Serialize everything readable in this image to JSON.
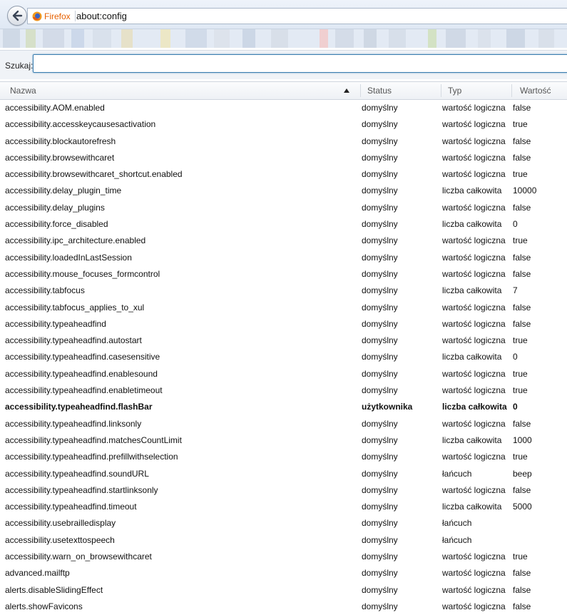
{
  "browser": {
    "identity_label": "Firefox",
    "url": "about:config",
    "accent": "#e66000"
  },
  "search": {
    "label": "Szukaj:",
    "value": ""
  },
  "columns": {
    "name": "Nazwa",
    "status": "Status",
    "type": "Typ",
    "value": "Wartość",
    "sorted_by": "name",
    "sort_icon": "triangle-up-icon"
  },
  "rows": [
    {
      "name": "accessibility.AOM.enabled",
      "status": "domyślny",
      "type": "wartość logiczna",
      "value": "false",
      "modified": false
    },
    {
      "name": "accessibility.accesskeycausesactivation",
      "status": "domyślny",
      "type": "wartość logiczna",
      "value": "true",
      "modified": false
    },
    {
      "name": "accessibility.blockautorefresh",
      "status": "domyślny",
      "type": "wartość logiczna",
      "value": "false",
      "modified": false
    },
    {
      "name": "accessibility.browsewithcaret",
      "status": "domyślny",
      "type": "wartość logiczna",
      "value": "false",
      "modified": false
    },
    {
      "name": "accessibility.browsewithcaret_shortcut.enabled",
      "status": "domyślny",
      "type": "wartość logiczna",
      "value": "true",
      "modified": false
    },
    {
      "name": "accessibility.delay_plugin_time",
      "status": "domyślny",
      "type": "liczba całkowita",
      "value": "10000",
      "modified": false
    },
    {
      "name": "accessibility.delay_plugins",
      "status": "domyślny",
      "type": "wartość logiczna",
      "value": "false",
      "modified": false
    },
    {
      "name": "accessibility.force_disabled",
      "status": "domyślny",
      "type": "liczba całkowita",
      "value": "0",
      "modified": false
    },
    {
      "name": "accessibility.ipc_architecture.enabled",
      "status": "domyślny",
      "type": "wartość logiczna",
      "value": "true",
      "modified": false
    },
    {
      "name": "accessibility.loadedInLastSession",
      "status": "domyślny",
      "type": "wartość logiczna",
      "value": "false",
      "modified": false
    },
    {
      "name": "accessibility.mouse_focuses_formcontrol",
      "status": "domyślny",
      "type": "wartość logiczna",
      "value": "false",
      "modified": false
    },
    {
      "name": "accessibility.tabfocus",
      "status": "domyślny",
      "type": "liczba całkowita",
      "value": "7",
      "modified": false
    },
    {
      "name": "accessibility.tabfocus_applies_to_xul",
      "status": "domyślny",
      "type": "wartość logiczna",
      "value": "false",
      "modified": false
    },
    {
      "name": "accessibility.typeaheadfind",
      "status": "domyślny",
      "type": "wartość logiczna",
      "value": "false",
      "modified": false
    },
    {
      "name": "accessibility.typeaheadfind.autostart",
      "status": "domyślny",
      "type": "wartość logiczna",
      "value": "true",
      "modified": false
    },
    {
      "name": "accessibility.typeaheadfind.casesensitive",
      "status": "domyślny",
      "type": "liczba całkowita",
      "value": "0",
      "modified": false
    },
    {
      "name": "accessibility.typeaheadfind.enablesound",
      "status": "domyślny",
      "type": "wartość logiczna",
      "value": "true",
      "modified": false
    },
    {
      "name": "accessibility.typeaheadfind.enabletimeout",
      "status": "domyślny",
      "type": "wartość logiczna",
      "value": "true",
      "modified": false
    },
    {
      "name": "accessibility.typeaheadfind.flashBar",
      "status": "użytkownika",
      "type": "liczba całkowita",
      "value": "0",
      "modified": true
    },
    {
      "name": "accessibility.typeaheadfind.linksonly",
      "status": "domyślny",
      "type": "wartość logiczna",
      "value": "false",
      "modified": false
    },
    {
      "name": "accessibility.typeaheadfind.matchesCountLimit",
      "status": "domyślny",
      "type": "liczba całkowita",
      "value": "1000",
      "modified": false
    },
    {
      "name": "accessibility.typeaheadfind.prefillwithselection",
      "status": "domyślny",
      "type": "wartość logiczna",
      "value": "true",
      "modified": false
    },
    {
      "name": "accessibility.typeaheadfind.soundURL",
      "status": "domyślny",
      "type": "łańcuch",
      "value": "beep",
      "modified": false
    },
    {
      "name": "accessibility.typeaheadfind.startlinksonly",
      "status": "domyślny",
      "type": "wartość logiczna",
      "value": "false",
      "modified": false
    },
    {
      "name": "accessibility.typeaheadfind.timeout",
      "status": "domyślny",
      "type": "liczba całkowita",
      "value": "5000",
      "modified": false
    },
    {
      "name": "accessibility.usebrailledisplay",
      "status": "domyślny",
      "type": "łańcuch",
      "value": "",
      "modified": false
    },
    {
      "name": "accessibility.usetexttospeech",
      "status": "domyślny",
      "type": "łańcuch",
      "value": "",
      "modified": false
    },
    {
      "name": "accessibility.warn_on_browsewithcaret",
      "status": "domyślny",
      "type": "wartość logiczna",
      "value": "true",
      "modified": false
    },
    {
      "name": "advanced.mailftp",
      "status": "domyślny",
      "type": "wartość logiczna",
      "value": "false",
      "modified": false
    },
    {
      "name": "alerts.disableSlidingEffect",
      "status": "domyślny",
      "type": "wartość logiczna",
      "value": "false",
      "modified": false
    },
    {
      "name": "alerts.showFavicons",
      "status": "domyślny",
      "type": "wartość logiczna",
      "value": "false",
      "modified": false
    }
  ]
}
